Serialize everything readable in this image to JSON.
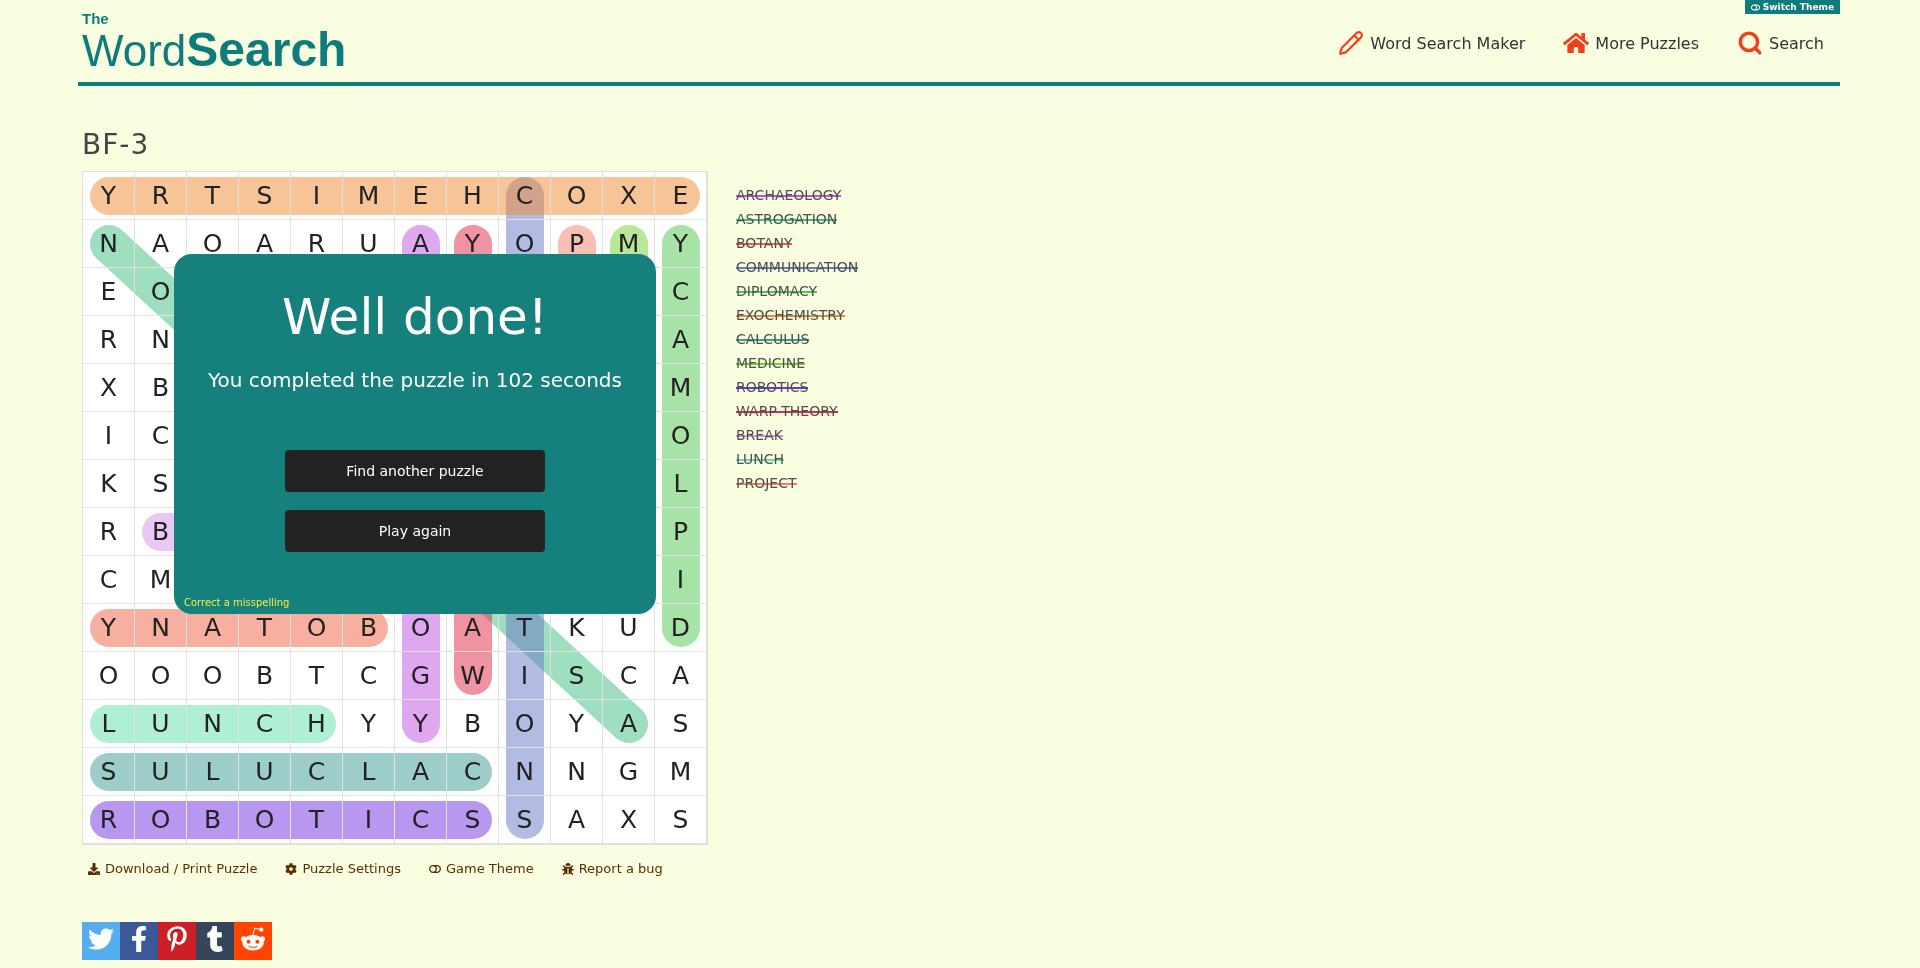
{
  "header": {
    "logo": {
      "small": "The",
      "regular": "Word",
      "bold": "Search"
    },
    "switch_theme": "Switch Theme",
    "nav": [
      {
        "kind": "maker",
        "label": "Word Search Maker"
      },
      {
        "kind": "more",
        "label": "More Puzzles"
      },
      {
        "kind": "search",
        "label": "Search"
      }
    ]
  },
  "puzzle": {
    "title": "BF-3",
    "grid": [
      {
        "letters": [
          "Y",
          "R",
          "T",
          "S",
          "I",
          "M",
          "E",
          "H",
          "C",
          "O",
          "X",
          "E"
        ]
      },
      {
        "letters": [
          "N",
          "A",
          "O",
          "A",
          "R",
          "U",
          "A",
          "Y",
          "O",
          "P",
          "M",
          "Y"
        ]
      },
      {
        "left": [
          "E",
          "O"
        ],
        "right": [
          "C"
        ]
      },
      {
        "left": [
          "R",
          "N"
        ],
        "right": [
          "A"
        ]
      },
      {
        "left": [
          "X",
          "B"
        ],
        "right": [
          "M"
        ]
      },
      {
        "left": [
          "I",
          "C"
        ],
        "right": [
          "O"
        ]
      },
      {
        "left": [
          "K",
          "S"
        ],
        "right": [
          "L"
        ]
      },
      {
        "left": [
          "R",
          "B"
        ],
        "right": [
          "P"
        ]
      },
      {
        "left": [
          "C",
          "M"
        ],
        "right": [
          "I"
        ]
      },
      {
        "letters": [
          "Y",
          "N",
          "A",
          "T",
          "O",
          "B",
          "O",
          "A",
          "T",
          "K",
          "U",
          "D"
        ]
      },
      {
        "letters": [
          "O",
          "O",
          "O",
          "B",
          "T",
          "C",
          "G",
          "W",
          "I",
          "S",
          "C",
          "A"
        ]
      },
      {
        "letters": [
          "L",
          "U",
          "N",
          "C",
          "H",
          "Y",
          "Y",
          "B",
          "O",
          "Y",
          "A",
          "S"
        ]
      },
      {
        "letters": [
          "S",
          "U",
          "L",
          "U",
          "C",
          "L",
          "A",
          "C",
          "N",
          "N",
          "G",
          "M"
        ]
      },
      {
        "letters": [
          "R",
          "O",
          "B",
          "O",
          "T",
          "I",
          "C",
          "S",
          "S",
          "A",
          "X",
          "S"
        ]
      }
    ],
    "words": [
      {
        "word": "ARCHAEOLOGY",
        "color": "#c050e0",
        "found": true
      },
      {
        "word": "ASTROGATION",
        "color": "#3cc080",
        "found": true
      },
      {
        "word": "BOTANY",
        "color": "#f06040",
        "found": true
      },
      {
        "word": "COMMUNICATION",
        "color": "#6878c8",
        "found": true
      },
      {
        "word": "DIPLOMACY",
        "color": "#50c850",
        "found": true
      },
      {
        "word": "EXOCHEMISTRY",
        "color": "#f08a30",
        "found": true
      },
      {
        "word": "CALCULUS",
        "color": "#3c9c94",
        "found": true
      },
      {
        "word": "MEDICINE",
        "color": "#70d030",
        "found": true
      },
      {
        "word": "ROBOTICS",
        "color": "#7030e0",
        "found": true
      },
      {
        "word": "WARP THEORY",
        "color": "#e02848",
        "found": true
      },
      {
        "word": "BREAK",
        "color": "#d890e8",
        "found": true
      },
      {
        "word": "LUNCH",
        "color": "#60e0a8",
        "found": true
      },
      {
        "word": "PROJECT",
        "color": "#f08068",
        "found": true
      }
    ]
  },
  "dialog": {
    "title": "Well done!",
    "message": "You completed the puzzle in 102 seconds",
    "buttons": [
      "Find another puzzle",
      "Play again"
    ],
    "link": "Correct a misspelling"
  },
  "tools": [
    {
      "kind": "download",
      "label": "Download / Print Puzzle"
    },
    {
      "kind": "settings",
      "label": "Puzzle Settings"
    },
    {
      "kind": "theme",
      "label": "Game Theme"
    },
    {
      "kind": "bug",
      "label": "Report a bug"
    }
  ],
  "share": [
    {
      "kind": "twitter"
    },
    {
      "kind": "facebook"
    },
    {
      "kind": "pinterest"
    },
    {
      "kind": "tumblr"
    },
    {
      "kind": "reddit"
    }
  ]
}
